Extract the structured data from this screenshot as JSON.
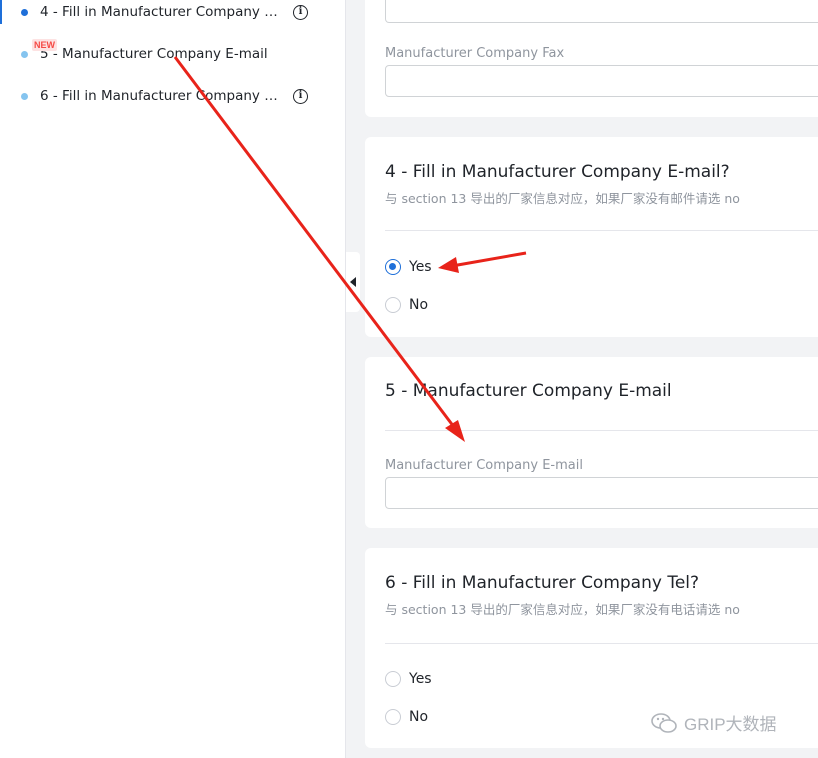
{
  "sidebar": {
    "items": [
      {
        "label": "4 - Fill in Manufacturer Company E-mail?",
        "active": true
      },
      {
        "label": "5 - Manufacturer Company E-mail",
        "badge": "NEW"
      },
      {
        "label": "6 - Fill in Manufacturer Company Tel?"
      }
    ]
  },
  "card_fax": {
    "field_label": "Manufacturer Company Fax",
    "value": ""
  },
  "q4": {
    "title": "4 - Fill in Manufacturer Company E-mail?",
    "description": "与 section 13 导出的厂家信息对应，如果厂家没有邮件请选 no",
    "options": [
      "Yes",
      "No"
    ],
    "selected": "Yes"
  },
  "q5": {
    "title": "5 - Manufacturer Company E-mail",
    "field_label": "Manufacturer Company E-mail",
    "value": ""
  },
  "q6": {
    "title": "6 - Fill in Manufacturer Company Tel?",
    "description": "与 section 13 导出的厂家信息对应，如果厂家没有电话请选 no",
    "options": [
      "Yes",
      "No"
    ],
    "selected": ""
  },
  "watermark": {
    "text": "GRIP大数据",
    "icon": "wechat-icon"
  },
  "colors": {
    "accent": "#1e6fd9",
    "annotation": "#e8231a",
    "badge": "#f54a45"
  }
}
